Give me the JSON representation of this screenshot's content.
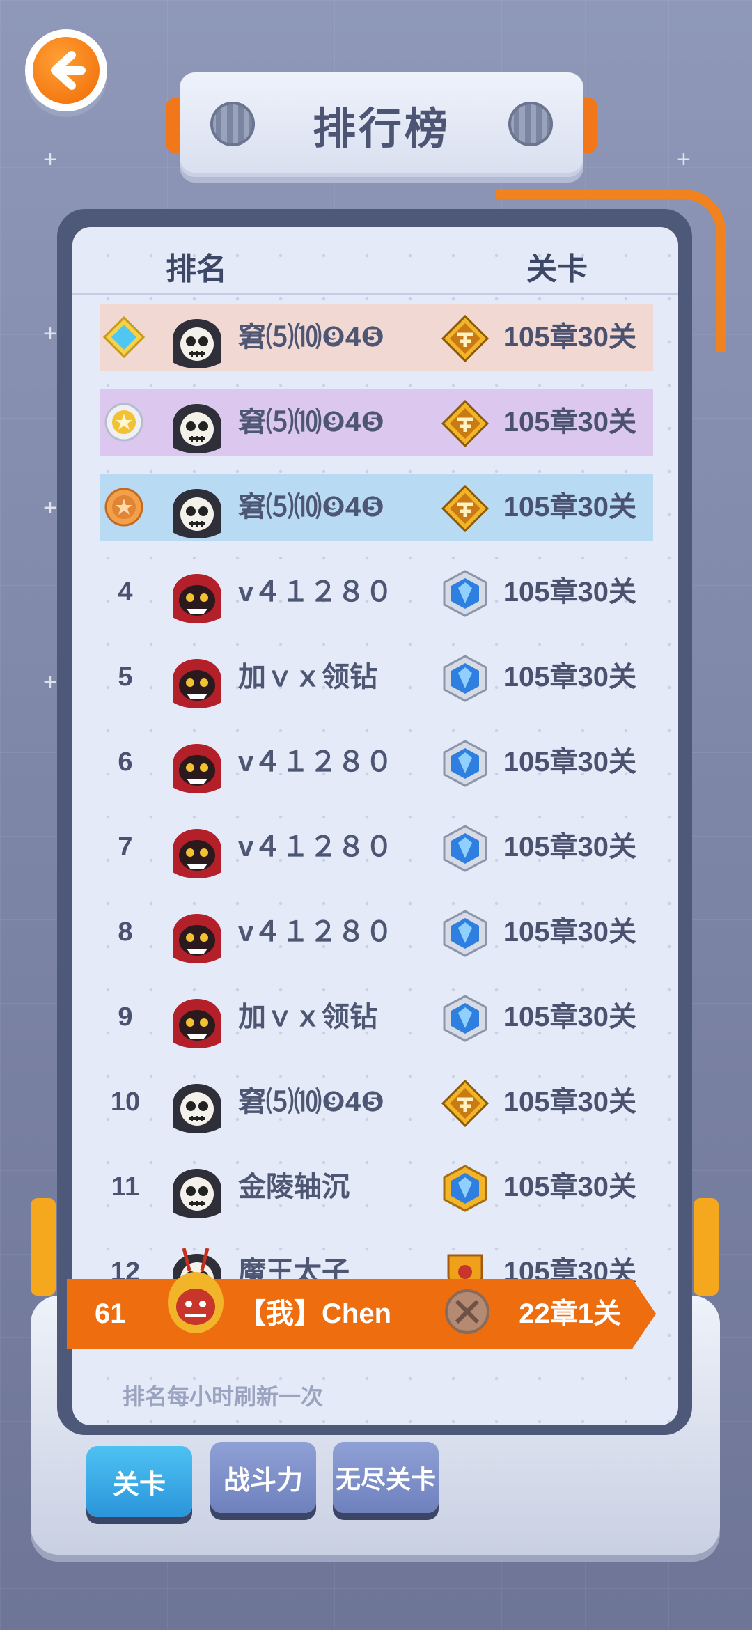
{
  "header": {
    "title": "排行榜"
  },
  "table": {
    "col_rank": "排名",
    "col_level": "关卡",
    "rows": [
      {
        "rank": "",
        "medal": "diamond-medal-icon",
        "avatar": "skull-hood-avatar",
        "name": "窘⑸⑽❾4❺",
        "badge": "gold-badge-icon",
        "level": "105章30关",
        "highlight": "#f2d8d2"
      },
      {
        "rank": "",
        "medal": "gold-star-medal-icon",
        "avatar": "skull-hood-avatar",
        "name": "窘⑸⑽❾4❺",
        "badge": "gold-badge-icon",
        "level": "105章30关",
        "highlight": "#dcc8ef"
      },
      {
        "rank": "",
        "medal": "bronze-star-medal-icon",
        "avatar": "skull-hood-avatar",
        "name": "窘⑸⑽❾4❺",
        "badge": "gold-badge-icon",
        "level": "105章30关",
        "highlight": "#b8daf3"
      },
      {
        "rank": "4",
        "avatar": "red-hood-avatar",
        "name": "v４１２８０",
        "badge": "blue-crystal-badge-icon",
        "level": "105章30关"
      },
      {
        "rank": "5",
        "avatar": "red-hood-avatar",
        "name": "加ｖｘ领钻",
        "badge": "blue-crystal-badge-icon",
        "level": "105章30关"
      },
      {
        "rank": "6",
        "avatar": "red-hood-avatar",
        "name": "v４１２８０",
        "badge": "blue-crystal-badge-icon",
        "level": "105章30关"
      },
      {
        "rank": "7",
        "avatar": "red-hood-avatar",
        "name": "v４１２８０",
        "badge": "blue-crystal-badge-icon",
        "level": "105章30关"
      },
      {
        "rank": "8",
        "avatar": "red-hood-avatar",
        "name": "v４１２８０",
        "badge": "blue-crystal-badge-icon",
        "level": "105章30关"
      },
      {
        "rank": "9",
        "avatar": "red-hood-avatar",
        "name": "加ｖｘ领钻",
        "badge": "blue-crystal-badge-icon",
        "level": "105章30关"
      },
      {
        "rank": "10",
        "avatar": "skull-hood-avatar",
        "name": "窘⑸⑽❾4❺",
        "badge": "gold-badge-icon",
        "level": "105章30关"
      },
      {
        "rank": "11",
        "avatar": "skull-hood-avatar",
        "name": "金陵轴沉",
        "badge": "gold-crystal-badge-icon",
        "level": "105章30关"
      },
      {
        "rank": "12",
        "avatar": "skull-hood-avatar",
        "name": "魔王太子",
        "badge": "shield-badge-icon",
        "level": "105章30关"
      }
    ]
  },
  "my_entry": {
    "rank": "61",
    "name": "【我】Chen",
    "badge": "bronze-locked-badge-icon",
    "level": "22章1关"
  },
  "note": "排名每小时刷新一次",
  "tabs": [
    {
      "label": "关卡",
      "active": true
    },
    {
      "label": "战斗力",
      "active": false
    },
    {
      "label": "无尽关卡",
      "active": false
    }
  ],
  "colors": {
    "accent_orange": "#ee6d0f",
    "panel_dark": "#4e5878",
    "tab_active": "#2a95da"
  }
}
